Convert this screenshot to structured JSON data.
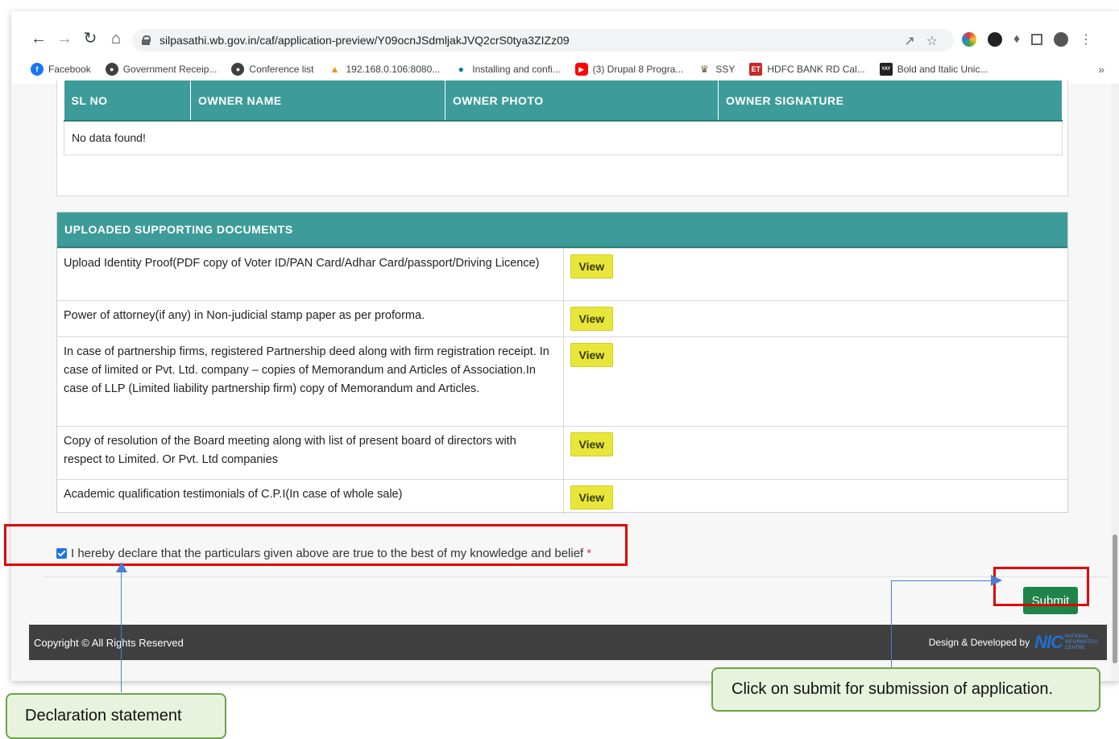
{
  "browser": {
    "url": "silpasathi.wb.gov.in/caf/application-preview/Y09ocnJSdmljakJVQ2crS0tya3ZIZz09",
    "bookmarks": [
      {
        "label": "Facebook",
        "icon": "facebook-icon",
        "color": "#1877f2"
      },
      {
        "label": "Government Receip...",
        "icon": "globe-icon",
        "color": "#3c4043"
      },
      {
        "label": "Conference list",
        "icon": "globe-icon",
        "color": "#3c4043"
      },
      {
        "label": "192.168.0.106:8080...",
        "icon": "pma-icon",
        "color": "#f29111"
      },
      {
        "label": "Installing and confi...",
        "icon": "drupal-icon",
        "color": "#0077c0"
      },
      {
        "label": "(3) Drupal 8 Progra...",
        "icon": "youtube-icon",
        "color": "#ff0000"
      },
      {
        "label": "SSY",
        "icon": "emblem-icon",
        "color": "#6b5b2e"
      },
      {
        "label": "HDFC BANK RD Cal...",
        "icon": "et-icon",
        "color": "#c62828"
      },
      {
        "label": "Bold and Italic Unic...",
        "icon": "yaytext-icon",
        "color": "#222222"
      }
    ],
    "more_label": "»"
  },
  "owners_table": {
    "headers": [
      "SL NO",
      "OWNER NAME",
      "OWNER PHOTO",
      "OWNER SIGNATURE"
    ],
    "empty_message": "No data found!"
  },
  "documents": {
    "heading": "UPLOADED SUPPORTING DOCUMENTS",
    "view_label": "View",
    "rows": [
      {
        "description": "Upload Identity Proof(PDF copy of Voter ID/PAN Card/Adhar Card/passport/Driving Licence)"
      },
      {
        "description": "Power of attorney(if any) in Non-judicial stamp paper as per proforma."
      },
      {
        "description": "In case of partnership firms, registered Partnership deed along with firm registration receipt. In case of limited or Pvt. Ltd. company – copies of Memorandum and Articles of Association.In case of LLP (Limited liability partnership firm) copy of Memorandum and Articles."
      },
      {
        "description": "Copy of resolution of the Board meeting along with list of present board of directors with respect to Limited. Or Pvt. Ltd companies"
      },
      {
        "description": "Academic qualification testimonials of C.P.I(In case of whole sale)"
      }
    ]
  },
  "declaration": {
    "text": "I hereby declare that the particulars given above are true to the best of my knowledge and belief",
    "required_mark": "*",
    "checked": true
  },
  "submit_label": "Submit",
  "footer": {
    "copyright": "Copyright © All Rights Reserved",
    "credit": "Design & Developed by",
    "logo_text": "NIC",
    "logo_sub": "NATIONAL INFORMATICS CENTRE"
  },
  "annotations": {
    "declaration_callout": "Declaration statement",
    "submit_callout": "Click on submit for submission of application.",
    "highlight_color": "#e00000",
    "callout_bg": "#e8f3de",
    "arrow_color": "#4a7ed0"
  },
  "colors": {
    "table_header": "#3d9c99",
    "view_button": "#e8e63a",
    "submit_button": "#1e8449",
    "footer_bg": "#404040"
  }
}
